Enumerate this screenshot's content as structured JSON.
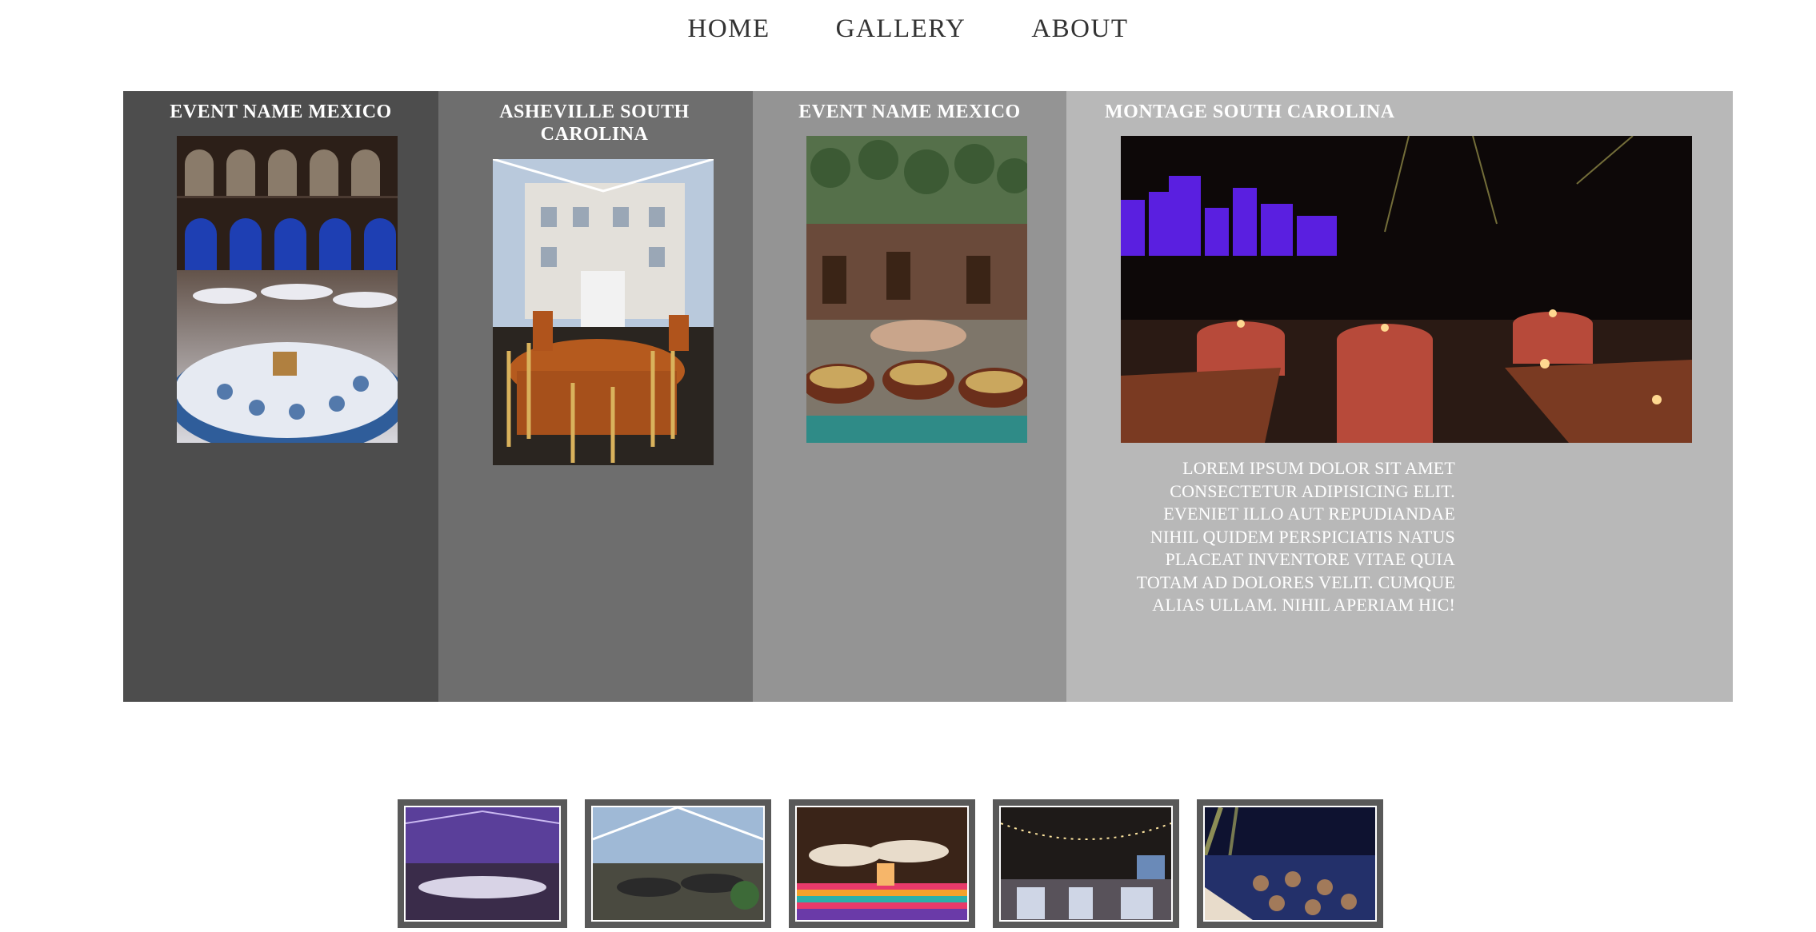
{
  "nav": {
    "home": "HOME",
    "gallery": "GALLERY",
    "about": "ABOUT"
  },
  "panels": [
    {
      "title": "EVENT NAME  MEXICO"
    },
    {
      "title": "ASHEVILLE  SOUTH CAROLINA"
    },
    {
      "title": "EVENT NAME  MEXICO"
    },
    {
      "title": "MONTAGE  SOUTH CAROLINA",
      "description": "LOREM IPSUM DOLOR SIT  AMET CONSECTETUR ADIPISICING ELIT. EVENIET ILLO AUT REPUDIANDAE NIHIL QUIDEM PERSPICIATIS NATUS PLACEAT  INVENTORE VITAE  QUIA TOTAM AD DOLORES VELIT. CUMQUE  ALIAS ULLAM. NIHIL  APERIAM HIC!"
    }
  ],
  "thumbnails": [
    {
      "icon": "purple-tent-event-photo"
    },
    {
      "icon": "clear-tent-event-photo"
    },
    {
      "icon": "mexican-fiesta-event-photo"
    },
    {
      "icon": "warehouse-string-lights-event-photo"
    },
    {
      "icon": "blue-venue-event-photo"
    }
  ],
  "colors": {
    "panel1": "#4d4d4d",
    "panel2": "#6e6e6e",
    "panel3": "#949494",
    "panel4": "#b8b8b8"
  }
}
